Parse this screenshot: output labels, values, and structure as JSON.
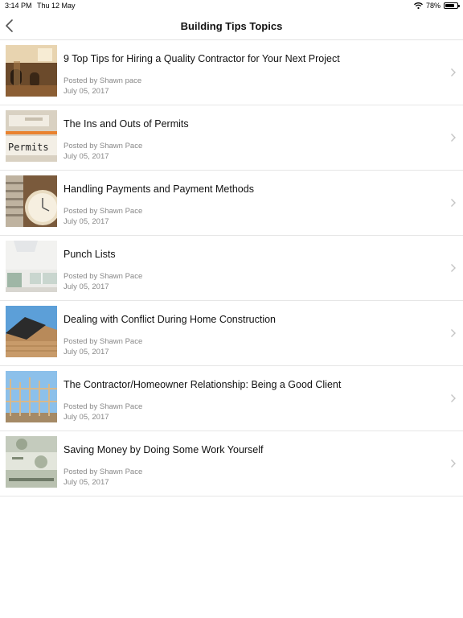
{
  "status": {
    "time": "3:14 PM",
    "date": "Thu 12 May",
    "battery": "78%",
    "battery_level": 0.78
  },
  "nav": {
    "title": "Building Tips Topics"
  },
  "articles": [
    {
      "title": "9 Top Tips for Hiring a Quality Contractor for Your Next Project",
      "author": "Posted by Shawn pace",
      "date": "July 05, 2017"
    },
    {
      "title": "The Ins and Outs of Permits",
      "author": "Posted by Shawn Pace",
      "date": "July 05, 2017",
      "thumb_text": "Permits"
    },
    {
      "title": "Handling Payments and Payment Methods",
      "author": "Posted by Shawn Pace",
      "date": "July 05, 2017"
    },
    {
      "title": "Punch Lists",
      "author": "Posted by Shawn Pace",
      "date": "July 05, 2017"
    },
    {
      "title": "Dealing with Conflict During Home Construction",
      "author": "Posted by Shawn Pace",
      "date": "July 05, 2017"
    },
    {
      "title": "The Contractor/Homeowner Relationship: Being a Good Client",
      "author": "Posted by Shawn Pace",
      "date": "July 05, 2017"
    },
    {
      "title": "Saving Money by Doing Some Work Yourself",
      "author": "Posted by Shawn Pace",
      "date": "July 05, 2017"
    }
  ]
}
